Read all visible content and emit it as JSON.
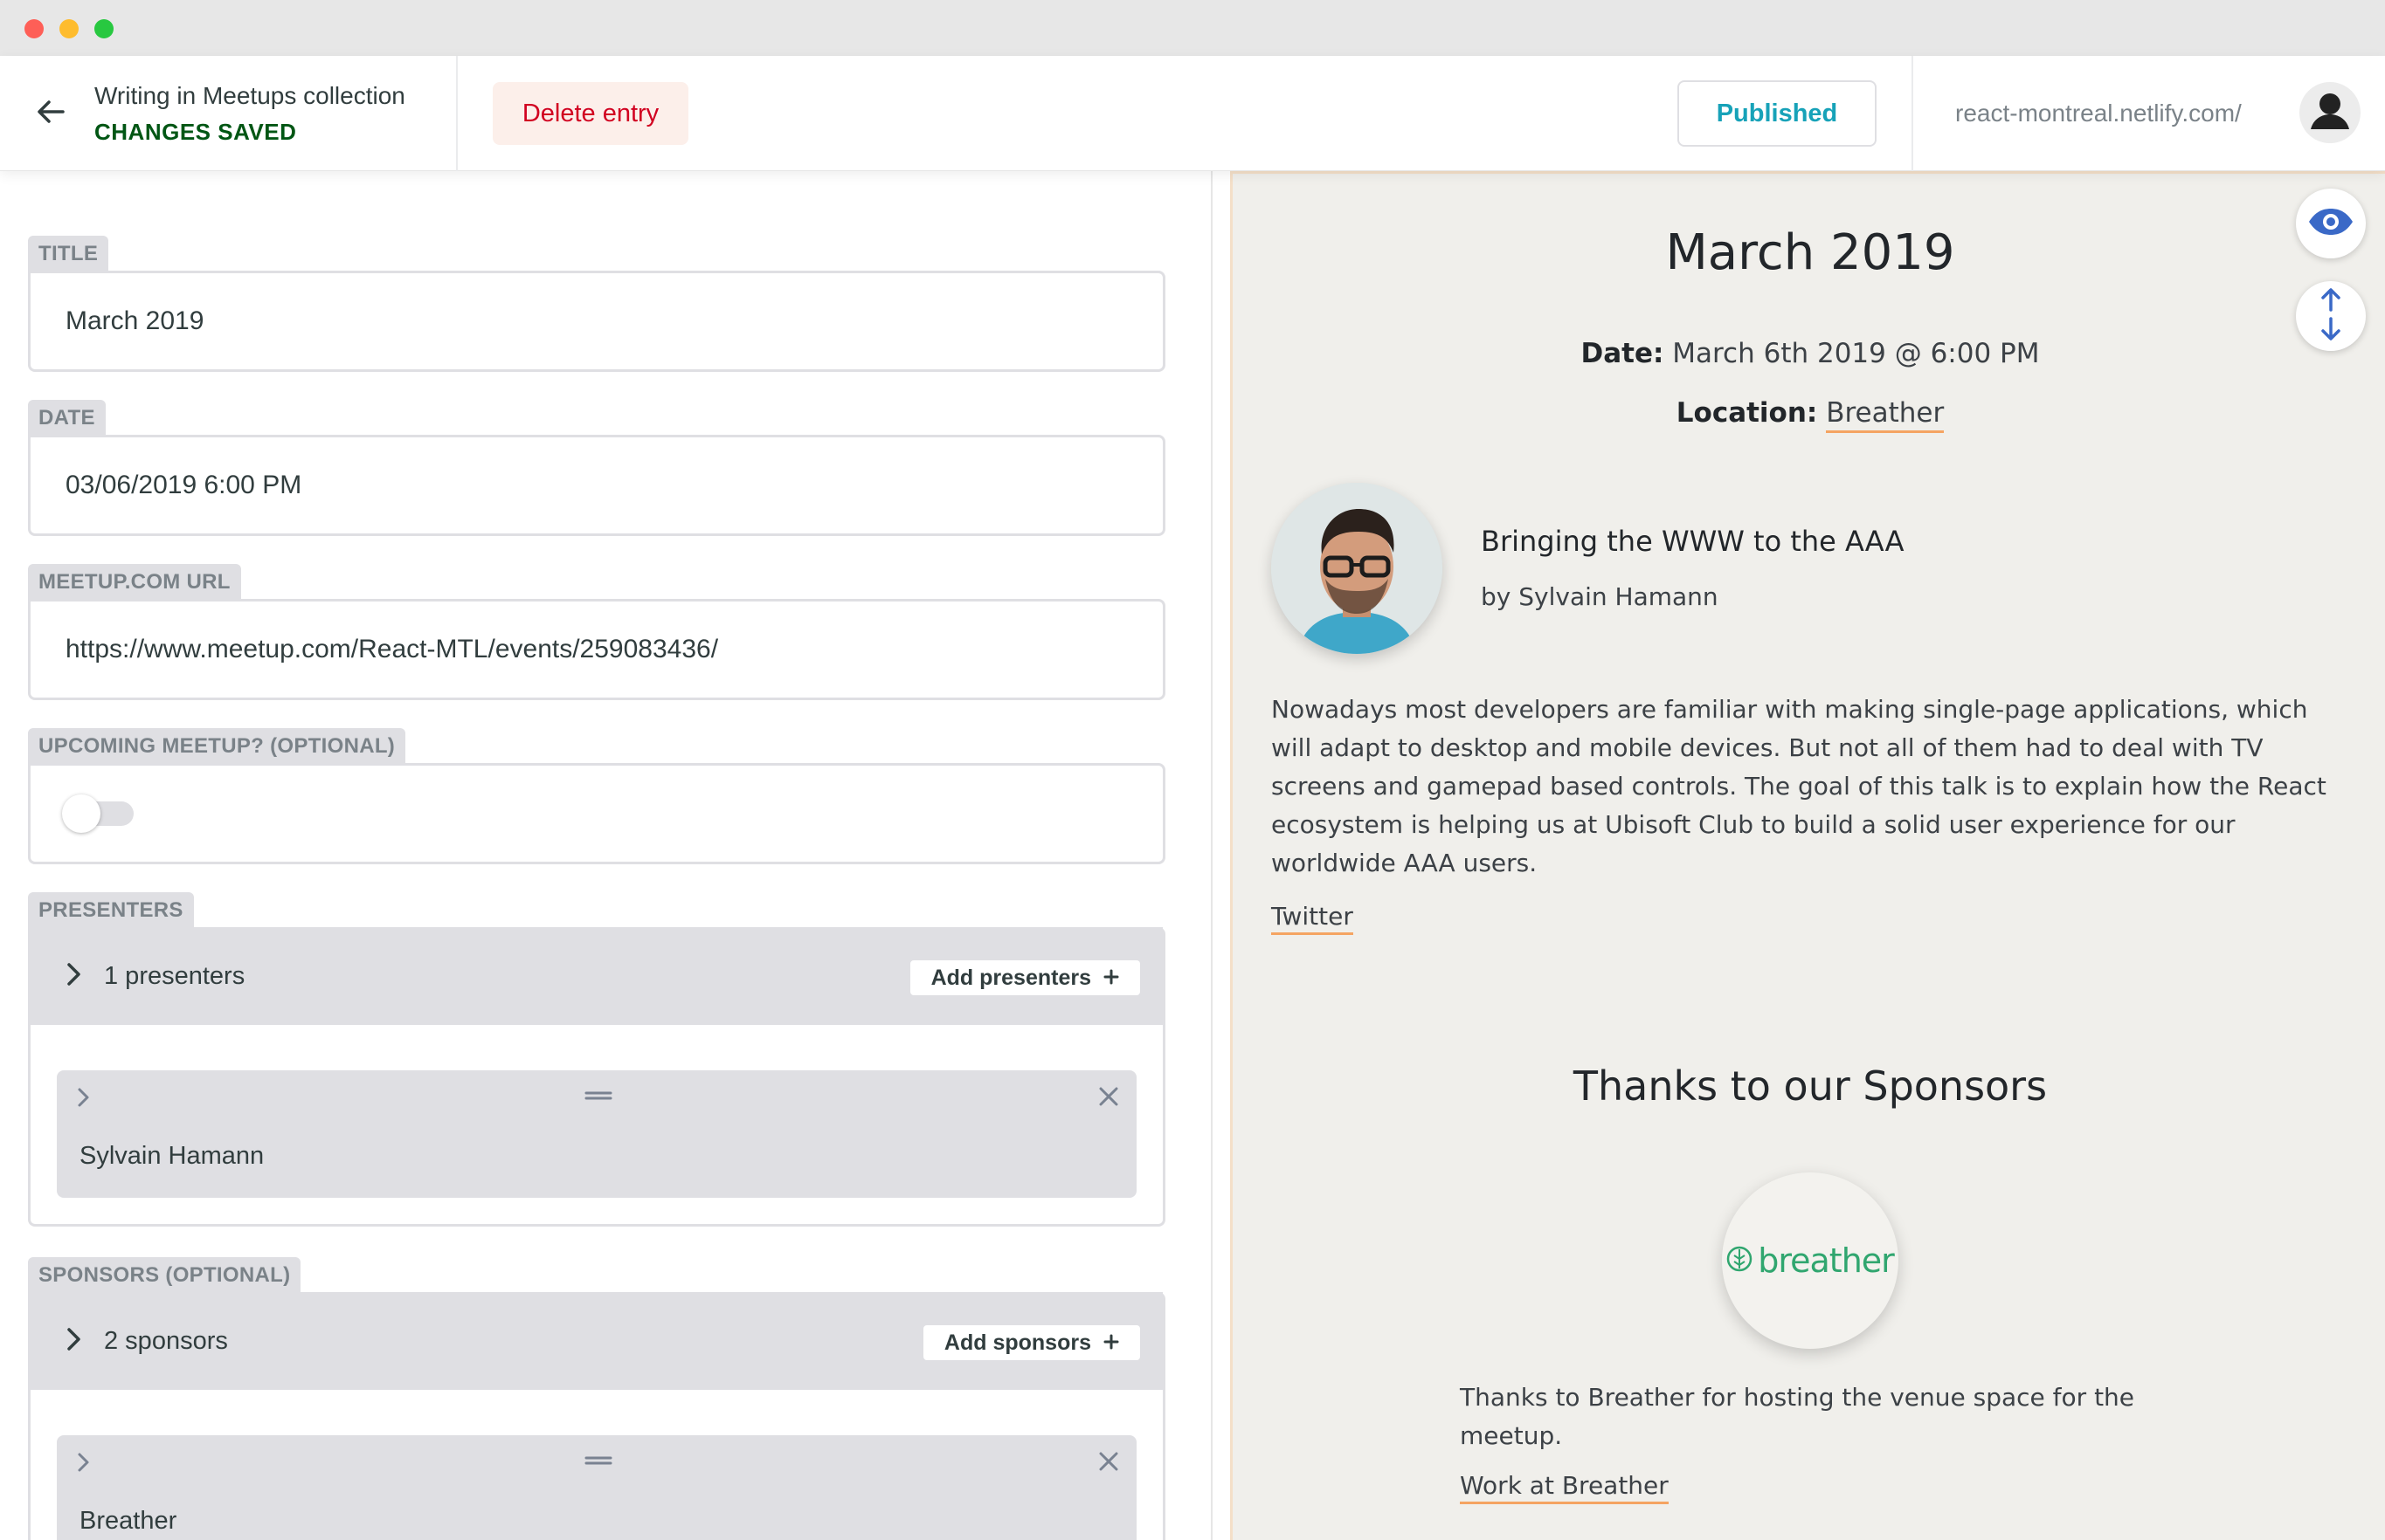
{
  "header": {
    "collection_title": "Writing in Meetups collection",
    "save_status": "CHANGES SAVED",
    "delete_label": "Delete entry",
    "publish_status": "Published",
    "site_url": "react-montreal.netlify.com/"
  },
  "fields": {
    "title": {
      "label": "TITLE",
      "value": "March 2019"
    },
    "date": {
      "label": "DATE",
      "value": "03/06/2019 6:00 PM"
    },
    "url": {
      "label": "MEETUP.COM URL",
      "value": "https://www.meetup.com/React-MTL/events/259083436/"
    },
    "upcoming": {
      "label": "UPCOMING MEETUP? (OPTIONAL)",
      "checked": false
    }
  },
  "presenters": {
    "label": "PRESENTERS",
    "count_text": "1 presenters",
    "add_label": "Add presenters",
    "items": [
      {
        "name": "Sylvain Hamann"
      }
    ]
  },
  "sponsors": {
    "label": "SPONSORS (OPTIONAL)",
    "count_text": "2 sponsors",
    "add_label": "Add sponsors",
    "items": [
      {
        "name": "Breather"
      }
    ]
  },
  "preview": {
    "title": "March 2019",
    "date_label": "Date:",
    "date_value": " March 6th 2019 @ 6:00 PM",
    "location_label": "Location:",
    "location_value": "Breather",
    "talk": {
      "title": "Bringing the WWW to the AAA",
      "author": "by Sylvain Hamann",
      "description": "Nowadays most developers are familiar with making single-page applications, which will adapt to desktop and mobile devices. But not all of them had to deal with TV screens and gamepad based controls. The goal of this talk is to explain how the React ecosystem is helping us at Ubisoft Club to build a solid user experience for our worldwide AAA users.",
      "link": "Twitter"
    },
    "sponsors_heading": "Thanks to our Sponsors",
    "sponsor": {
      "logo_text": "breather",
      "description": "Thanks to Breather for hosting the venue space for the meetup.",
      "link": "Work at Breather"
    }
  },
  "colors": {
    "accent": "#17a2b8",
    "saved": "#005614",
    "danger": "#d10020",
    "preview_bg": "#f0efeb",
    "link_underline": "#f5a462",
    "brand_breather": "#30a66f",
    "preview_icons": "#3a69c7"
  },
  "icons": {
    "back": "arrow-left-icon",
    "account": "user-avatar-icon",
    "preview_toggle": "eye-icon",
    "scroll_sync": "scroll-sync-icon",
    "expand": "chevron-right-icon",
    "drag": "drag-handle-icon",
    "remove": "close-icon",
    "add": "plus-icon"
  }
}
